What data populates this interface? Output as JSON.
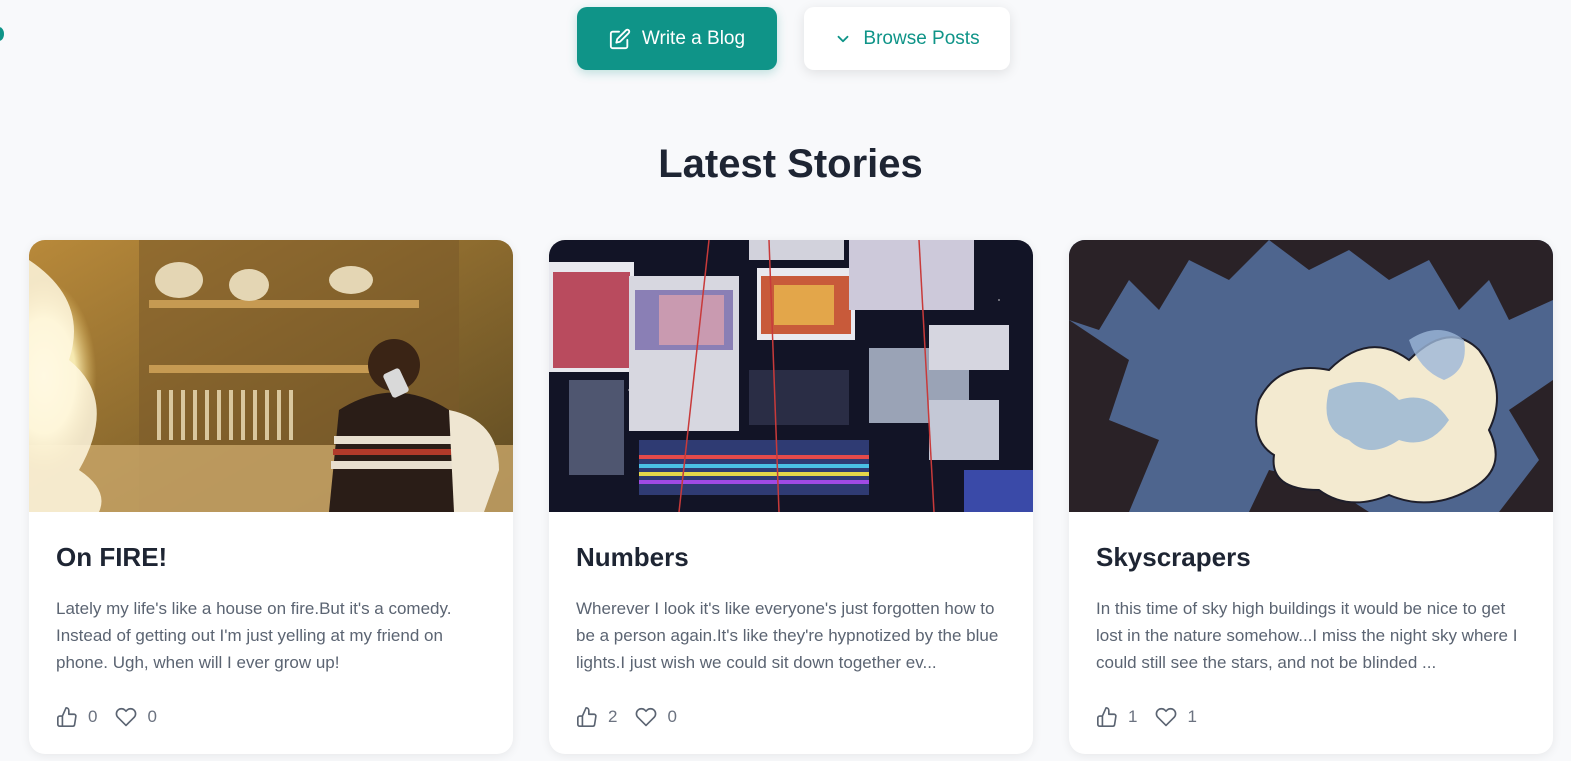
{
  "actions": {
    "write_label": "Write a Blog",
    "browse_label": "Browse Posts",
    "write_icon": "edit-icon",
    "browse_icon": "chevron-down-icon"
  },
  "section": {
    "title": "Latest Stories"
  },
  "colors": {
    "accent": "#0f9488",
    "title": "#1e2533",
    "text": "#5b6472",
    "background": "#f8f9fb"
  },
  "posts": [
    {
      "title": "On FIRE!",
      "excerpt": "Lately my life's like a house on fire.But it's a comedy. Instead of getting out I'm just yelling at my friend on phone. Ugh, when will I ever grow up!",
      "likes": "0",
      "hearts": "0",
      "image": "kitchen-fire-photo"
    },
    {
      "title": "Numbers",
      "excerpt": "Wherever I look it's like everyone's just forgotten how to be a person again.It's like they're hypnotized by the blue lights.I just wish we could sit down together ev...",
      "likes": "2",
      "hearts": "0",
      "image": "screens-glitch-photo"
    },
    {
      "title": "Skyscrapers",
      "excerpt": "In this time of sky high buildings it would be nice to get lost in the nature somehow...I miss the night sky where I could still see the stars, and not be blinded ...",
      "likes": "1",
      "hearts": "1",
      "image": "skyscrapers-sky-photo"
    }
  ]
}
